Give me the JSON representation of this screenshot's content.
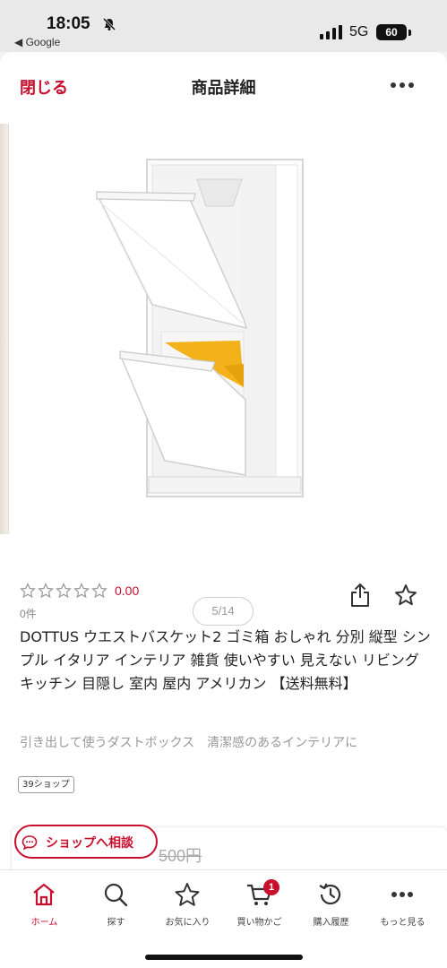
{
  "status_bar": {
    "time": "18:05",
    "back_app": "◀ Google",
    "network": "5G",
    "battery": "60"
  },
  "header": {
    "close_label": "閉じる",
    "title": "商品詳細"
  },
  "gallery": {
    "page_indicator": "5/14"
  },
  "product": {
    "stars_filled": 0,
    "stars_total": 5,
    "rating": "0.00",
    "review_count": "0件",
    "name": "DOTTUS ウエストバスケット2 ゴミ箱 おしゃれ 分別 縦型 シンプル イタリア インテリア 雑貨 使いやすい 見えない リビング キッチン 目隠し 室内 屋内 アメリカン 【送料無料】",
    "catchcopy": "引き出して使うダストボックス　清潔感のあるインテリアに",
    "shop_badge": "39ショップ",
    "price_partial": "500円"
  },
  "consult_button": {
    "label": "ショップへ相談"
  },
  "tabbar": {
    "items": [
      {
        "label": "ホーム",
        "icon": "home-icon",
        "active": true
      },
      {
        "label": "探す",
        "icon": "search-icon",
        "active": false
      },
      {
        "label": "お気に入り",
        "icon": "star-icon",
        "active": false
      },
      {
        "label": "買い物かご",
        "icon": "cart-icon",
        "active": false,
        "badge": "1"
      },
      {
        "label": "購入履歴",
        "icon": "history-icon",
        "active": false
      },
      {
        "label": "もっと見る",
        "icon": "more-icon",
        "active": false
      }
    ]
  },
  "colors": {
    "accent": "#c8102e",
    "bin_inner": "#f3b21a",
    "bin_body": "#ffffff"
  }
}
